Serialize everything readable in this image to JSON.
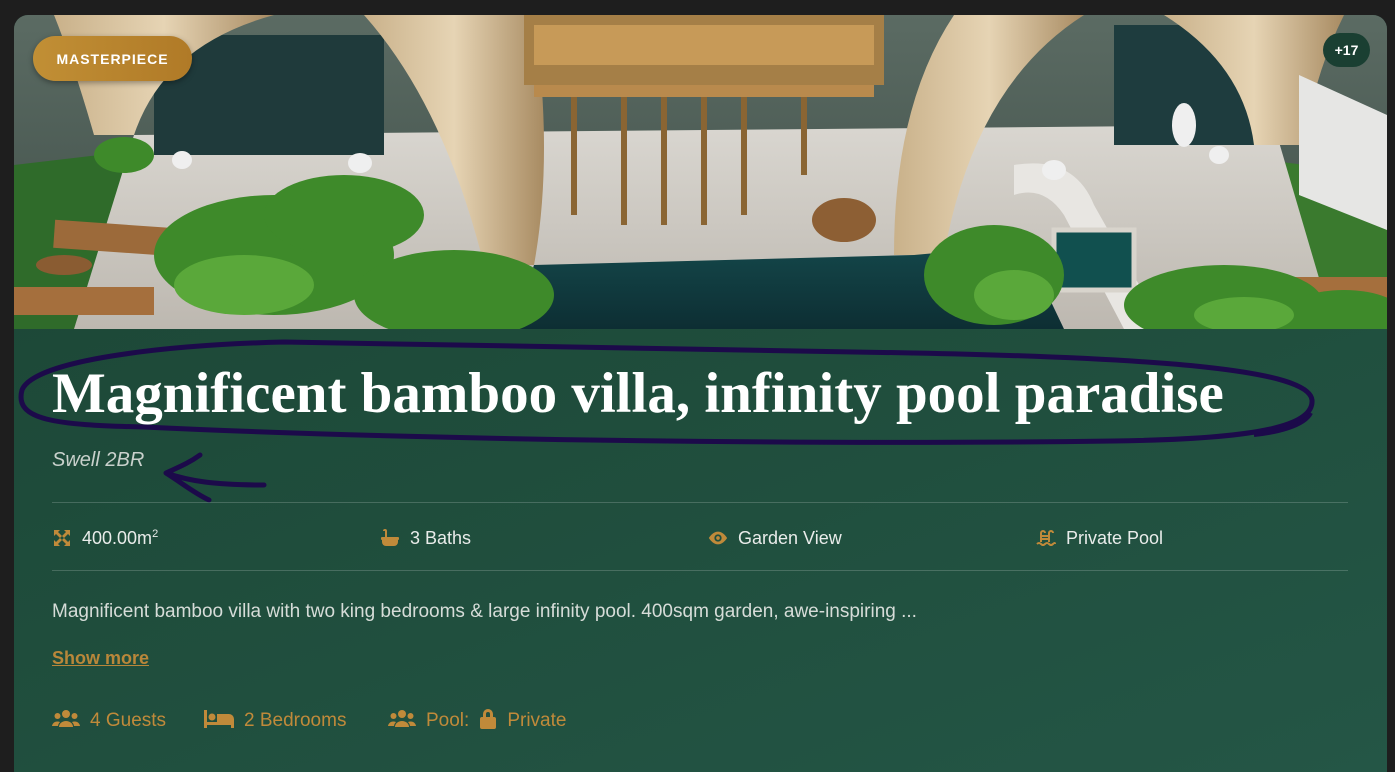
{
  "listing": {
    "badge": "MASTERPIECE",
    "photo_count": "+17",
    "title": "Magnificent bamboo villa, infinity pool paradise",
    "subtitle": "Swell 2BR",
    "features": [
      {
        "icon": "area-icon",
        "label": "400.00m",
        "sup": "2"
      },
      {
        "icon": "bathtub-icon",
        "label": "3 Baths"
      },
      {
        "icon": "eye-icon",
        "label": "Garden View"
      },
      {
        "icon": "pool-icon",
        "label": "Private Pool"
      }
    ],
    "description": "Magnificent bamboo villa with two king bedrooms & large infinity pool. 400sqm garden, awe-inspiring ...",
    "show_more": "Show more",
    "stats": {
      "guests": "4 Guests",
      "bedrooms": "2 Bedrooms",
      "pool_prefix": "Pool:",
      "pool_value": "Private"
    }
  },
  "colors": {
    "accent": "#b9873a",
    "card_bg": "#1f4d3c",
    "annotation": "#1c0a4a"
  }
}
